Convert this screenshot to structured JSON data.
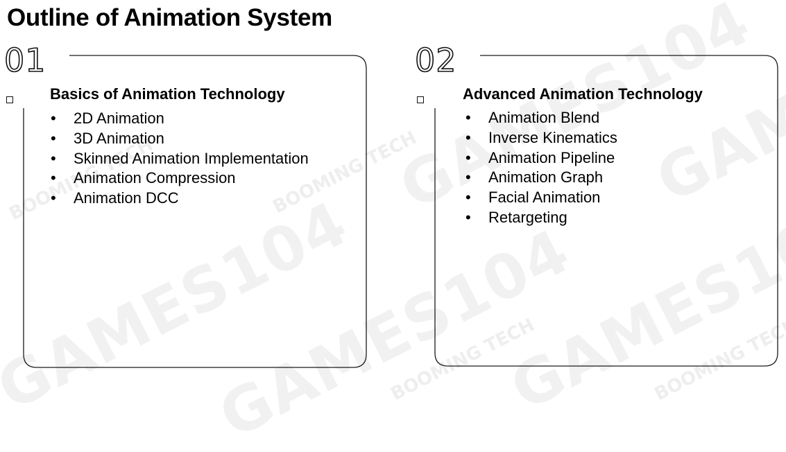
{
  "title": "Outline of Animation System",
  "watermarks": {
    "brand": "GAMES104",
    "studio": "BOOMING TECH"
  },
  "cards": [
    {
      "number": "01",
      "heading": "Basics of Animation Technology",
      "items": [
        "2D Animation",
        "3D Animation",
        "Skinned Animation Implementation",
        "Animation Compression",
        "Animation DCC"
      ]
    },
    {
      "number": "02",
      "heading": "Advanced Animation Technology",
      "items": [
        "Animation Blend",
        "Inverse Kinematics",
        "Animation Pipeline",
        "Animation Graph",
        "Facial Animation",
        "Retargeting"
      ]
    }
  ]
}
